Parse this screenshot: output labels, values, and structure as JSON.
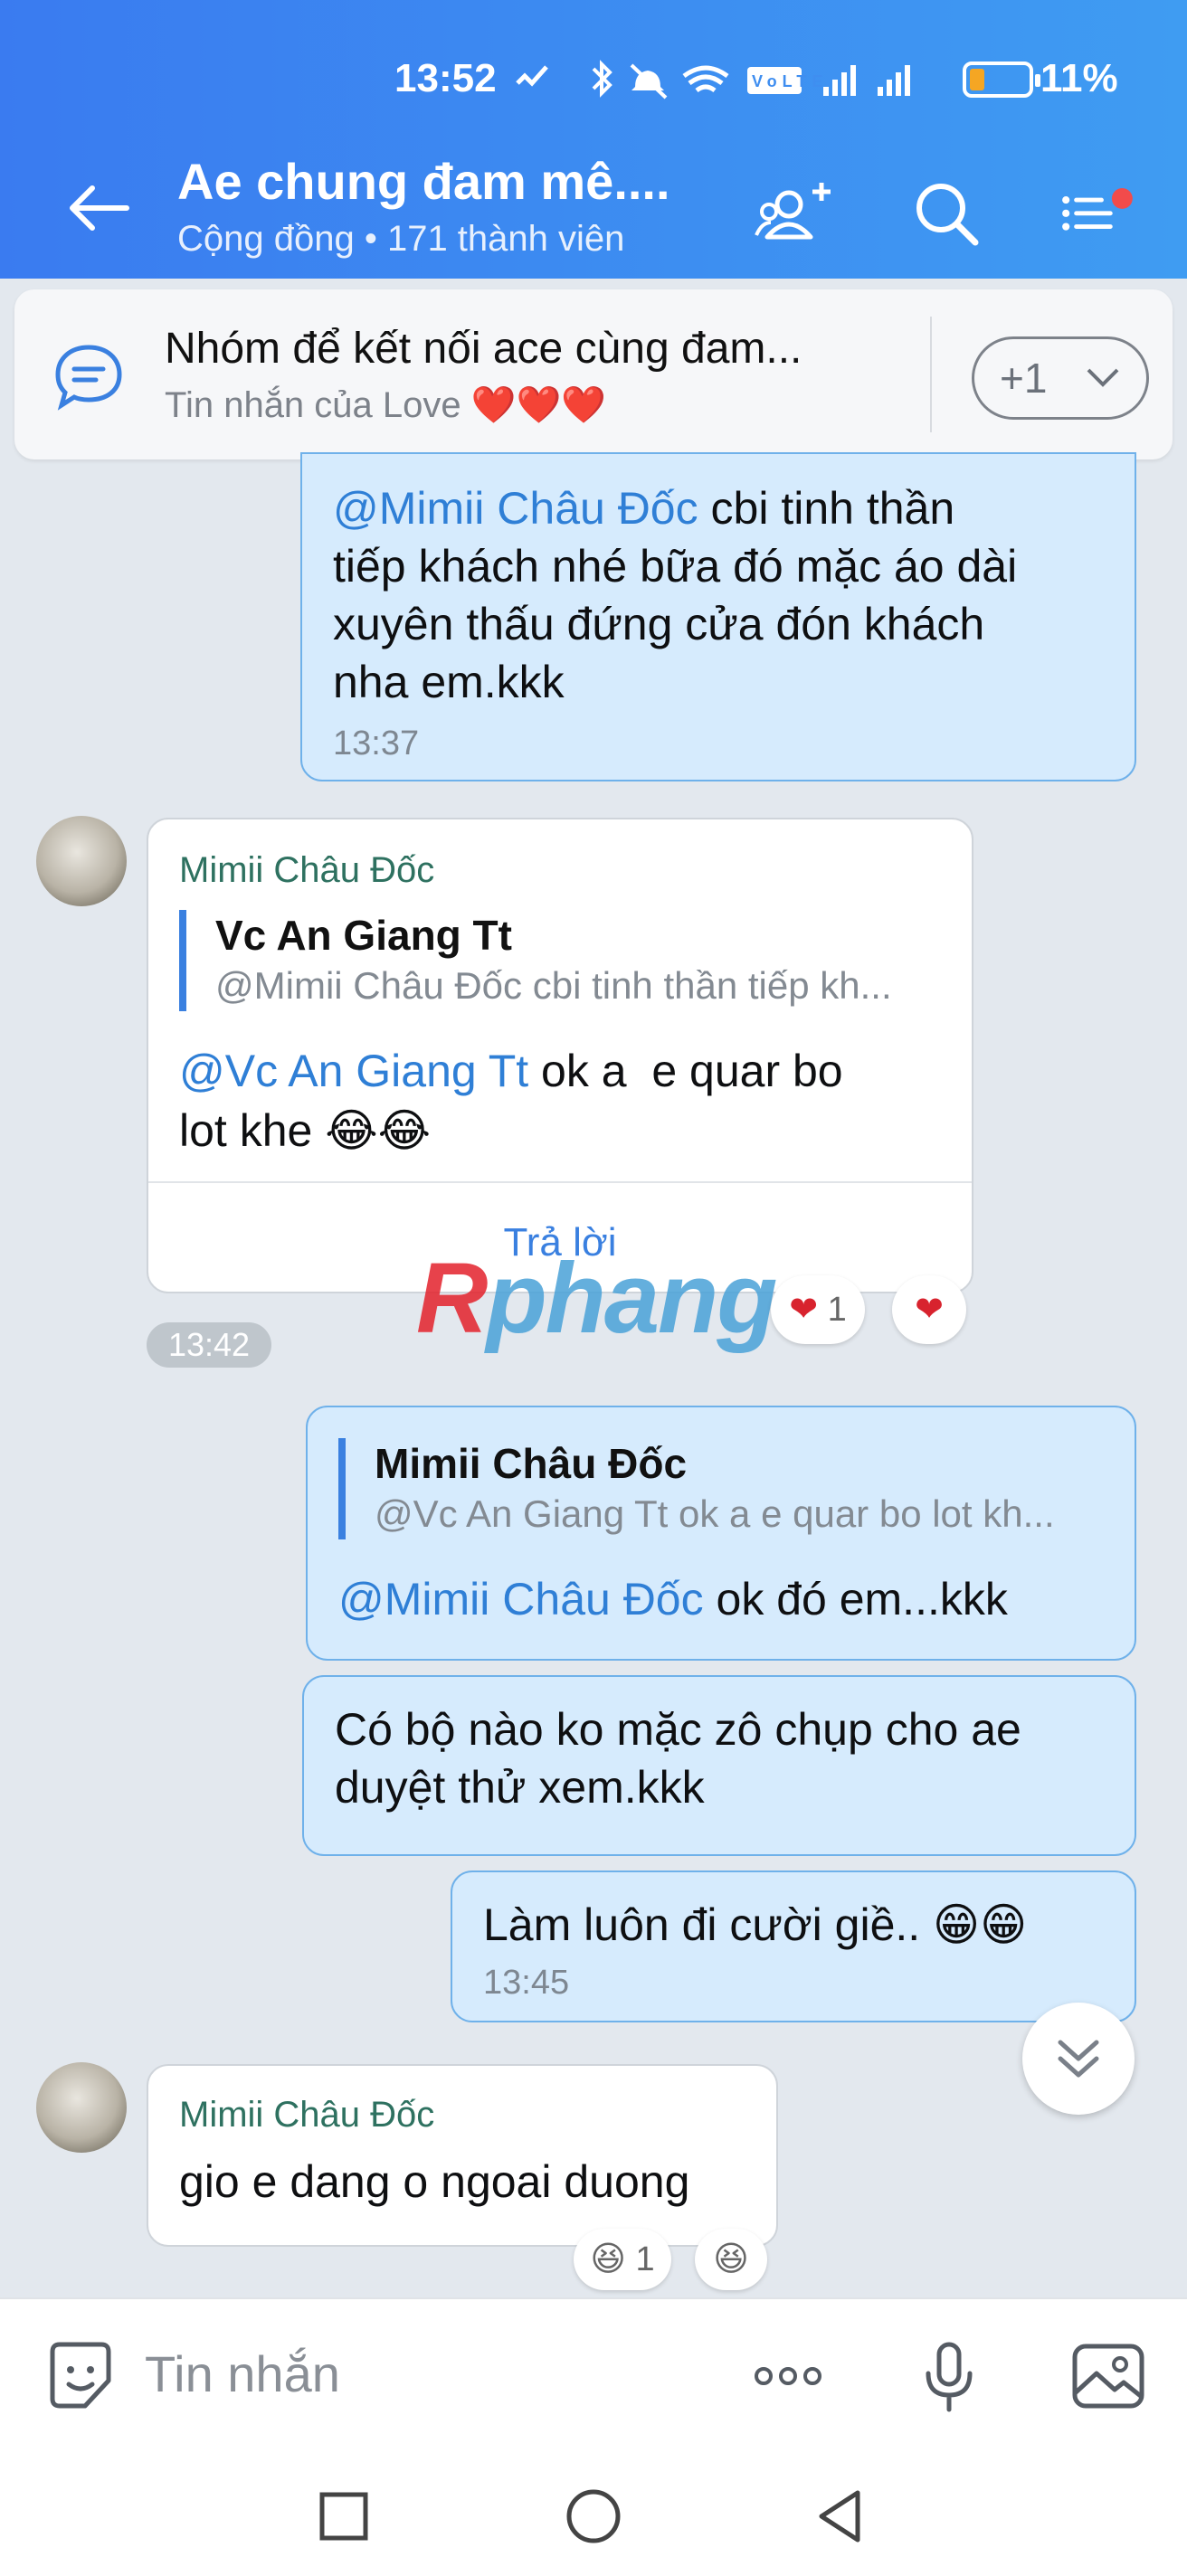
{
  "status_bar": {
    "time": "13:52",
    "battery": "11%",
    "icons": [
      "checkmark-icon",
      "bluetooth-icon",
      "mute-icon",
      "wifi-icon",
      "volte-icon",
      "signal-icon",
      "signal-icon",
      "battery-icon"
    ]
  },
  "header": {
    "title": "Ae chung đam mê....",
    "subtitle": "Cộng đồng • 171 thành viên",
    "accent": "#3f8ef0"
  },
  "pinned": {
    "title": "Nhóm để kết nối ace cùng đam...",
    "subtitle": "Tin nhắn của Love ❤️❤️❤️",
    "pill": "+1"
  },
  "messages": {
    "m1": {
      "mention": "@Mimii Châu Đốc",
      "lines": [
        "cbi tinh thần",
        "tiếp khách nhé bữa đó mặc áo dài",
        "xuyên thấu đứng cửa đón khách",
        "nha em.kkk"
      ],
      "time": "13:37"
    },
    "m2": {
      "sender": "Mimii Châu Đốc",
      "quote_name": "Vc An Giang Tt",
      "quote_text": "@Mimii Châu Đốc cbi tinh thần tiếp kh...",
      "mention": "@Vc An Giang Tt",
      "line1_rest": " ok a  e quar bo",
      "line2": "lot khe 😂😂",
      "reply_label": "Trả lời",
      "time": "13:42",
      "reaction_count": "1"
    },
    "m3": {
      "quote_name": "Mimii Châu Đốc",
      "quote_text": "@Vc An Giang Tt ok a  e quar bo lot kh...",
      "mention": "@Mimii Châu Đốc",
      "rest": " ok đó em...kkk"
    },
    "m4": {
      "lines": [
        "Có bộ nào ko mặc zô chụp cho ae",
        "duyệt thử xem.kkk"
      ]
    },
    "m5": {
      "text": "Làm luôn đi cười giề.. 😁😁",
      "time": "13:45"
    },
    "m6": {
      "sender": "Mimii Châu Đốc",
      "text": "gio e dang o ngoai duong",
      "reaction_count": "1"
    }
  },
  "watermark": {
    "r": "R",
    "rest": "phang"
  },
  "input": {
    "placeholder": "Tin nhắn"
  }
}
